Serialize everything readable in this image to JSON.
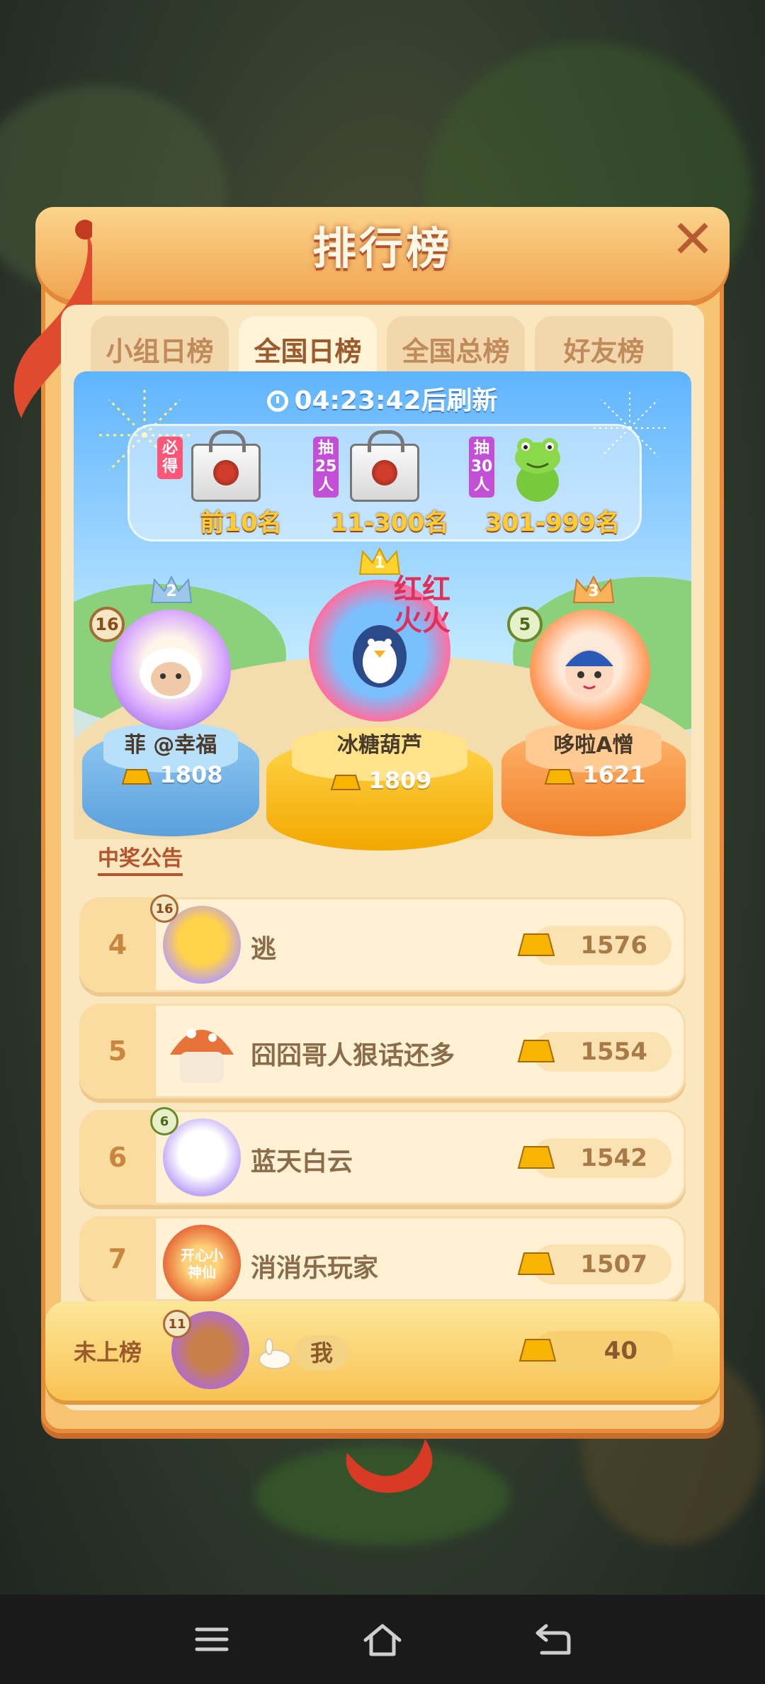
{
  "header": {
    "title": "排行榜",
    "close_label": "✕"
  },
  "tabs": [
    {
      "label": "小组日榜",
      "active": false
    },
    {
      "label": "全国日榜",
      "active": true
    },
    {
      "label": "全国总榜",
      "active": false
    },
    {
      "label": "好友榜",
      "active": false
    }
  ],
  "countdown": {
    "time": "04:23:42",
    "suffix": "后刷新"
  },
  "prizes": [
    {
      "tag": "必得",
      "range": "前10名",
      "tag_color": "#ff5577"
    },
    {
      "tag": "抽25人",
      "range": "11-300名",
      "tag_color": "#c24fd6"
    },
    {
      "tag": "抽30人",
      "range": "301-999名",
      "tag_color": "#c24fd6"
    }
  ],
  "podium": [
    {
      "rank": "2",
      "level": "16",
      "name": "菲 @幸福",
      "score": "1808"
    },
    {
      "rank": "1",
      "badge_text": "红红火火",
      "name": "冰糖葫芦",
      "score": "1809"
    },
    {
      "rank": "3",
      "level": "5",
      "name": "哆啦A憎",
      "score": "1621"
    }
  ],
  "announcement": "中奖公告",
  "rows": [
    {
      "rank": "4",
      "level": "16",
      "name": "逃",
      "score": "1576"
    },
    {
      "rank": "5",
      "name": "囧囧哥人狠话还多",
      "score": "1554"
    },
    {
      "rank": "6",
      "level": "6",
      "name": "蓝天白云",
      "score": "1542"
    },
    {
      "rank": "7",
      "name": "消消乐玩家",
      "score": "1507",
      "avatar_text": "开心小神仙"
    }
  ],
  "me": {
    "rank_label": "未上榜",
    "level": "11",
    "name": "我",
    "score": "40"
  },
  "colors": {
    "gold": "#ffcc33",
    "accent": "#e58b3a",
    "text_brown": "#8a6b4a"
  }
}
